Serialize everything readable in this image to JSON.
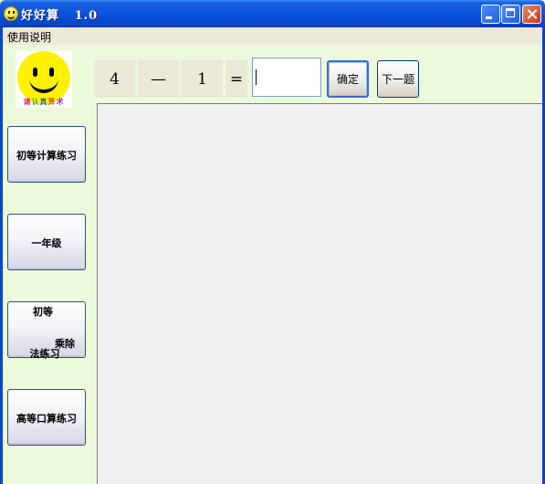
{
  "window": {
    "title": "好好算   1.0",
    "icon": "smiley-icon"
  },
  "menu": {
    "items": [
      "使用说明"
    ]
  },
  "logo": {
    "caption_chars": [
      "请",
      "认",
      "真",
      "算",
      "术"
    ]
  },
  "sidebar": {
    "buttons": [
      {
        "lines": [
          "初等计算练习"
        ]
      },
      {
        "lines": [
          "一年级"
        ]
      },
      {
        "lines": [
          "初等",
          "乘除",
          "法练习"
        ]
      },
      {
        "lines": [
          "高等口算练习"
        ]
      }
    ]
  },
  "equation": {
    "operand_a": "4",
    "operator": "—",
    "operand_b": "1",
    "equals": "=",
    "answer_value": ""
  },
  "actions": {
    "confirm_label": "确定",
    "next_label": "下一题"
  },
  "colors": {
    "client_bg": "#ecfadb",
    "titlebar": "#0a52dc",
    "face": "#fff200"
  }
}
